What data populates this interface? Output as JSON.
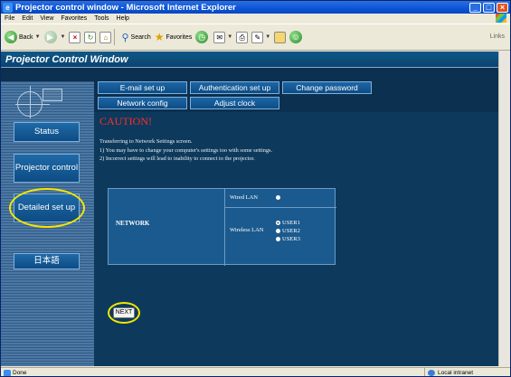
{
  "window": {
    "title": "Projector control window - Microsoft Internet Explorer"
  },
  "menu": [
    "File",
    "Edit",
    "View",
    "Favorites",
    "Tools",
    "Help"
  ],
  "toolbar": {
    "back": "Back",
    "search": "Search",
    "favorites": "Favorites",
    "links": "Links"
  },
  "page": {
    "header": "Projector Control Window",
    "sidebar": {
      "status": "Status",
      "projector_control": "Projector control",
      "detailed_setup": "Detailed set up",
      "language": "日本語"
    },
    "tabs": {
      "email": "E-mail set up",
      "auth": "Authentication set up",
      "change_password": "Change password",
      "network_config": "Network config",
      "adjust_clock": "Adjust clock"
    },
    "caution": "CAUTION!",
    "notes": {
      "line1": "Transferring to Network Settings screen.",
      "line2": "1)   You may have to change your computer's settings too with some settings.",
      "line3": "2)   Incorrect settings will lead to inability to connect to the projector."
    },
    "network": {
      "label": "NETWORK",
      "wired": "Wired LAN",
      "wireless": "Wireless LAN",
      "users": [
        "USER1",
        "USER2",
        "USER3"
      ],
      "selected": "USER1"
    },
    "next": "NEXT"
  },
  "statusbar": {
    "done": "Done",
    "zone": "Local intranet"
  },
  "colors": {
    "highlight": "#f4e600",
    "caution": "#ff2b2b",
    "page_bg": "#0b3050"
  }
}
